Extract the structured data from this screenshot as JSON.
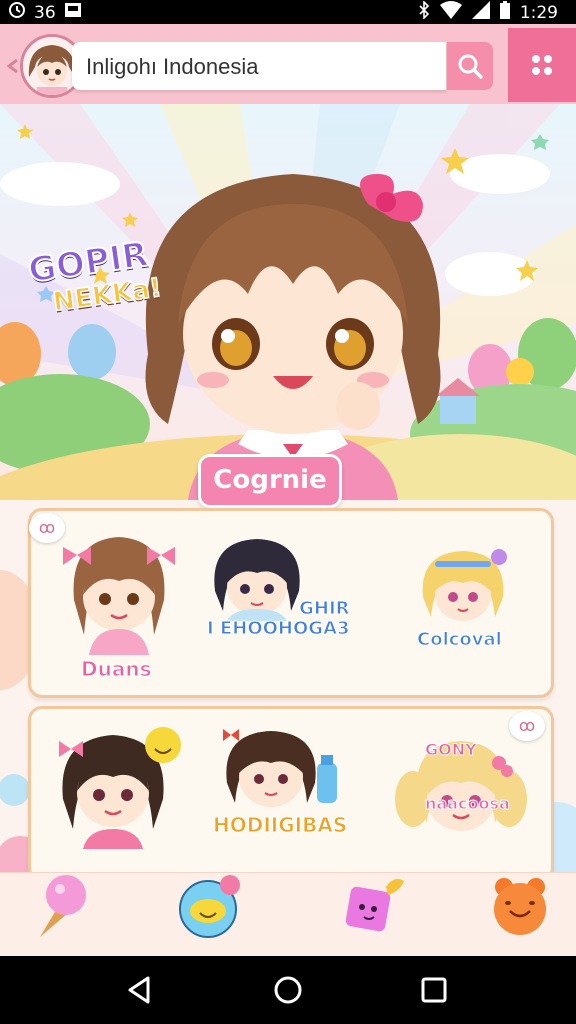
{
  "status_bar": {
    "left_value": "36",
    "time": "1:29"
  },
  "search": {
    "value": "Inligohı Indonesia"
  },
  "hero": {
    "logo_line1": "GOPIR",
    "logo_line2": "NEKKa!",
    "badge_label": "Cogrnie"
  },
  "cards": [
    {
      "badge": "ꝏ",
      "stickers": [
        {
          "label": "Duans",
          "color": "#ee5fa0"
        },
        {
          "label": "GHIR\nI EHOOHOGA3",
          "color": "#3f7fe0"
        },
        {
          "label": "Colcoval",
          "color": "#3f7fe0"
        }
      ]
    },
    {
      "badge": "ꝏ",
      "stickers": [
        {
          "label": "",
          "color": "#ee5fa0"
        },
        {
          "label": "HODIIGIBAS",
          "color": "#f0a020"
        },
        {
          "label": "GONY\nnaacoosa",
          "color": "#ee5fa0"
        }
      ]
    }
  ],
  "bottom_nav": [
    {
      "name": "ice-cream",
      "icon": "ice-cream-icon"
    },
    {
      "name": "bubble",
      "icon": "chat-bubble-icon"
    },
    {
      "name": "candy",
      "icon": "candy-icon"
    },
    {
      "name": "bear",
      "icon": "bear-icon"
    }
  ]
}
